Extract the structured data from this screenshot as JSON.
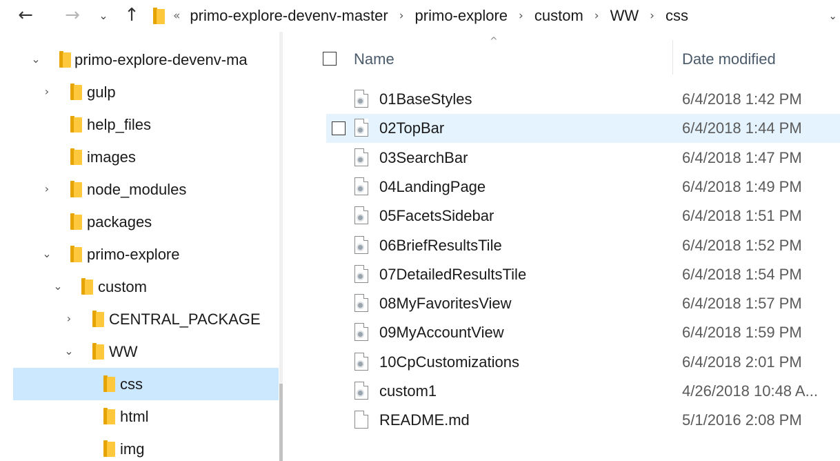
{
  "address_bar": {
    "overflow": "«",
    "crumbs": [
      "primo-explore-devenv-master",
      "primo-explore",
      "custom",
      "WW",
      "css"
    ]
  },
  "nav_tree": [
    {
      "label": "primo-explore-devenv-ma",
      "chevron": "expanded",
      "level": 0
    },
    {
      "label": "gulp",
      "chevron": "collapsed",
      "level": 1
    },
    {
      "label": "help_files",
      "chevron": "none",
      "level": 1
    },
    {
      "label": "images",
      "chevron": "none",
      "level": 1
    },
    {
      "label": "node_modules",
      "chevron": "collapsed",
      "level": 1
    },
    {
      "label": "packages",
      "chevron": "none",
      "level": 1
    },
    {
      "label": "primo-explore",
      "chevron": "expanded",
      "level": 1
    },
    {
      "label": "custom",
      "chevron": "expanded",
      "level": 2
    },
    {
      "label": "CENTRAL_PACKAGE",
      "chevron": "collapsed",
      "level": 3
    },
    {
      "label": "WW",
      "chevron": "expanded",
      "level": 3
    },
    {
      "label": "css",
      "chevron": "none",
      "level": 4,
      "selected": true
    },
    {
      "label": "html",
      "chevron": "none",
      "level": 4
    },
    {
      "label": "img",
      "chevron": "none",
      "level": 4
    }
  ],
  "columns": {
    "name": "Name",
    "date": "Date modified"
  },
  "files": [
    {
      "name": "01BaseStyles",
      "date": "6/4/2018 1:42 PM",
      "icon": "css-file-icon"
    },
    {
      "name": "02TopBar",
      "date": "6/4/2018 1:44 PM",
      "icon": "css-file-icon",
      "hover": true
    },
    {
      "name": "03SearchBar",
      "date": "6/4/2018 1:47 PM",
      "icon": "css-file-icon"
    },
    {
      "name": "04LandingPage",
      "date": "6/4/2018 1:49 PM",
      "icon": "css-file-icon"
    },
    {
      "name": "05FacetsSidebar",
      "date": "6/4/2018 1:51 PM",
      "icon": "css-file-icon"
    },
    {
      "name": "06BriefResultsTile",
      "date": "6/4/2018 1:52 PM",
      "icon": "css-file-icon"
    },
    {
      "name": "07DetailedResultsTile",
      "date": "6/4/2018 1:54 PM",
      "icon": "css-file-icon"
    },
    {
      "name": "08MyFavoritesView",
      "date": "6/4/2018 1:57 PM",
      "icon": "css-file-icon"
    },
    {
      "name": "09MyAccountView",
      "date": "6/4/2018 1:59 PM",
      "icon": "css-file-icon"
    },
    {
      "name": "10CpCustomizations",
      "date": "6/4/2018 2:01 PM",
      "icon": "css-file-icon"
    },
    {
      "name": "custom1",
      "date": "4/26/2018 10:48 A...",
      "icon": "css-file-icon"
    },
    {
      "name": "README.md",
      "date": "5/1/2016 2:08 PM",
      "icon": "text-file-icon"
    }
  ],
  "colors": {
    "selection": "#cce8ff",
    "hover": "#e5f3ff",
    "folder": "#ffc83d"
  }
}
